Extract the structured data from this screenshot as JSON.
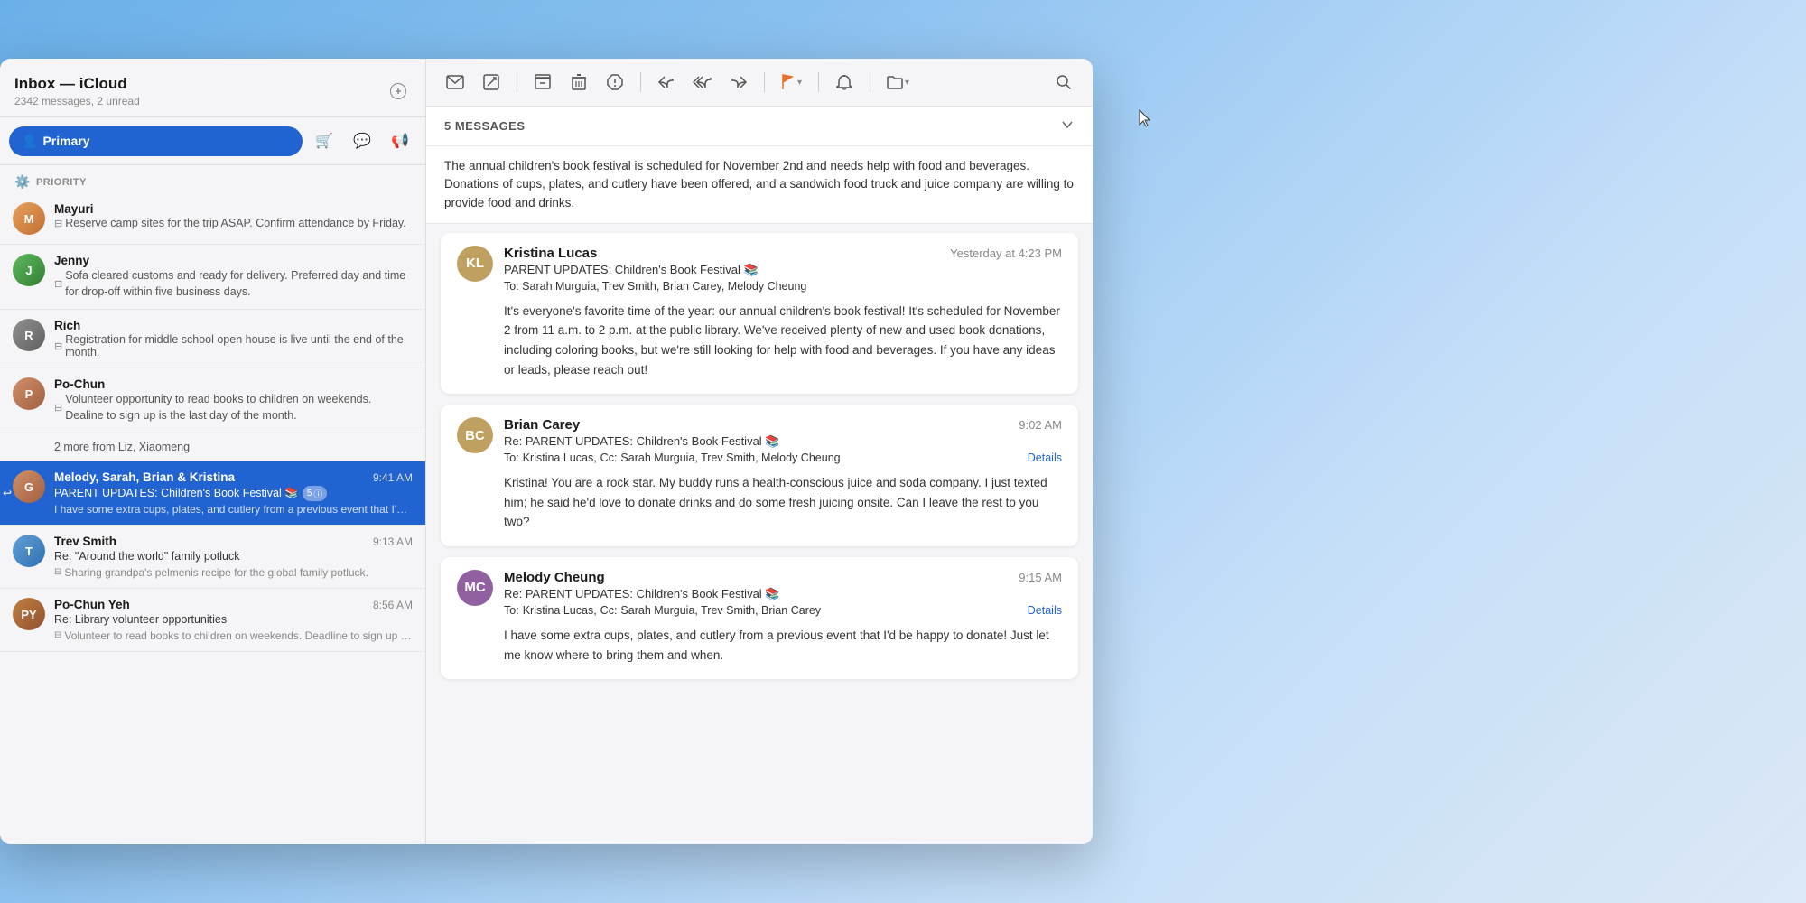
{
  "sidebar": {
    "title": "Inbox — iCloud",
    "subtitle": "2342 messages, 2 unread",
    "compose_label": "✏️",
    "tabs": {
      "primary_label": "Primary",
      "shopping_icon": "🛒",
      "chat_icon": "💬",
      "notification_icon": "📢"
    },
    "priority_label": "PRIORITY",
    "emails": [
      {
        "id": "mayuri",
        "sender": "Mayuri",
        "subject": "Reserve camp sites for the trip ASAP. Confirm attendance by Friday.",
        "preview": "",
        "time": "",
        "avatar_initials": "M",
        "avatar_class": "av-m"
      },
      {
        "id": "jenny",
        "sender": "Jenny",
        "subject": "Sofa cleared customs and ready for delivery. Preferred day and time for drop-off within five business days.",
        "preview": "",
        "time": "",
        "avatar_initials": "J",
        "avatar_class": "av-j"
      },
      {
        "id": "rich",
        "sender": "Rich",
        "subject": "Registration for middle school open house is live until the end of the month.",
        "preview": "",
        "time": "",
        "avatar_initials": "R",
        "avatar_class": "av-r"
      },
      {
        "id": "pochun",
        "sender": "Po-Chun",
        "subject": "Volunteer opportunity to read books to children on weekends. Dealine to sign up is the last day of the month.",
        "preview": "",
        "time": "",
        "avatar_initials": "P",
        "avatar_class": "av-p"
      }
    ],
    "more_from": "2 more from Liz, Xiaomeng",
    "selected_email": {
      "sender": "Melody, Sarah, Brian & Kristina",
      "time": "9:41 AM",
      "subject": "PARENT UPDATES: Children's Book Festival 📚",
      "badge": "5",
      "preview": "I have some extra cups, plates, and cutlery from a previous event that I'd be happy to donate! Just let me know where..."
    },
    "trev_email": {
      "sender": "Trev Smith",
      "time": "9:13 AM",
      "subject": "Re: \"Around the world\" family potluck",
      "preview": "Sharing grandpa's pelmenis recipe for the global family potluck."
    },
    "pochun2_email": {
      "sender": "Po-Chun Yeh",
      "time": "8:56 AM",
      "subject": "Re: Library volunteer opportunities",
      "preview": "Volunteer to read books to children on weekends. Deadline to sign up is the last day of the month."
    }
  },
  "toolbar": {
    "mail_icon": "✉",
    "compose_icon": "✏",
    "archive_icon": "⬡",
    "trash_icon": "🗑",
    "junk_icon": "⊗",
    "reply_icon": "↩",
    "reply_all_icon": "↩↩",
    "forward_icon": "↪",
    "flag_icon": "⚑",
    "remind_icon": "🔔",
    "move_icon": "📁",
    "search_icon": "🔍"
  },
  "thread": {
    "count_label": "5 MESSAGES",
    "summary": "The annual children's book festival is scheduled for November 2nd and needs help with food and beverages. Donations of cups, plates, and cutlery have been offered, and a sandwich food truck and juice company are willing to provide food and drinks.",
    "messages": [
      {
        "id": "kristina",
        "sender": "Kristina Lucas",
        "time": "Yesterday at 4:23 PM",
        "subject": "PARENT UPDATES: Children's Book Festival 📚",
        "to_label": "To:",
        "to_recipients": "Sarah Murguia,   Trev Smith,   Brian Carey,   Melody Cheung",
        "body": "It's everyone's favorite time of the year: our annual children's book festival! It's scheduled for November 2 from 11 a.m. to 2 p.m. at the public library. We've received plenty of new and used book donations, including coloring books, but we're still looking for help with food and beverages. If you have any ideas or leads, please reach out!",
        "avatar_initials": "KL",
        "avatar_class": "msg-avatar-kristina",
        "has_details": false
      },
      {
        "id": "brian",
        "sender": "Brian Carey",
        "time": "9:02 AM",
        "subject": "Re: PARENT UPDATES: Children's Book Festival 📚",
        "to_label": "To:",
        "to_recipients": "Kristina Lucas,",
        "cc_label": "Cc:",
        "cc_recipients": "Sarah Murguia,   Trev Smith,   Melody Cheung",
        "body": "Kristina! You are a rock star. My buddy runs a health-conscious juice and soda company. I just texted him; he said he'd love to donate drinks and do some fresh juicing onsite. Can I leave the rest to you two?",
        "avatar_initials": "BC",
        "avatar_class": "msg-avatar-brian",
        "has_details": true
      },
      {
        "id": "melody",
        "sender": "Melody Cheung",
        "time": "9:15 AM",
        "subject": "Re: PARENT UPDATES: Children's Book Festival 📚",
        "to_label": "To:",
        "to_recipients": "Kristina Lucas,",
        "cc_label": "Cc:",
        "cc_recipients": "Sarah Murguia,   Trev Smith,   Brian Carey",
        "body": "I have some extra cups, plates, and cutlery from a previous event that I'd be happy to donate! Just let me know where to bring them and when.",
        "avatar_initials": "MC",
        "avatar_class": "msg-avatar-melody",
        "has_details": true
      }
    ]
  }
}
